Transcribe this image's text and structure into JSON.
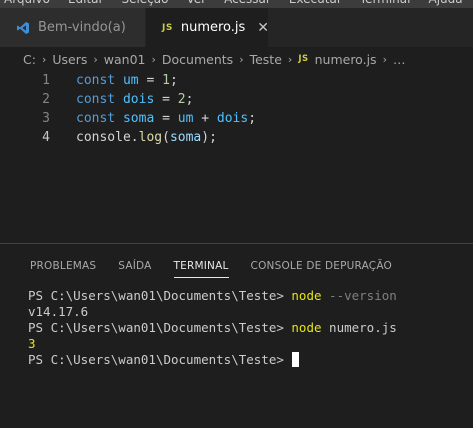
{
  "menu": [
    "Arquivo",
    "Editar",
    "Seleção",
    "Ver",
    "Acessar",
    "Executar",
    "Terminal",
    "Ajuda"
  ],
  "tabs": [
    {
      "label": "Bem-vindo(a)",
      "icon": "vscode-icon"
    },
    {
      "label": "numero.js",
      "icon": "js-file-icon",
      "badge": "JS",
      "close": "✕"
    }
  ],
  "breadcrumb": {
    "items": [
      "C:",
      "Users",
      "wan01",
      "Documents",
      "Teste"
    ],
    "file_badge": "JS",
    "file": "numero.js",
    "more": "…"
  },
  "editor": {
    "line_numbers": [
      "1",
      "2",
      "3",
      "4"
    ],
    "lines": [
      {
        "kw": "const",
        "name": "um",
        "op": "=",
        "val": "1",
        "end": ";"
      },
      {
        "kw": "const",
        "name": "dois",
        "op": "=",
        "val": "2",
        "end": ";"
      },
      {
        "kw": "const",
        "name": "soma",
        "op": "=",
        "a": "um",
        "plus": "+",
        "b": "dois",
        "end": ";"
      },
      {
        "obj": "console",
        "dot": ".",
        "fn": "log",
        "open": "(",
        "arg": "soma",
        "close": ");"
      }
    ]
  },
  "panel": {
    "tabs": [
      "PROBLEMAS",
      "SAÍDA",
      "TERMINAL",
      "CONSOLE DE DEPURAÇÃO"
    ],
    "active_tab": "TERMINAL"
  },
  "terminal": {
    "prompt": "PS C:\\Users\\wan01\\Documents\\Teste>",
    "cmd1": "node",
    "arg1": "--version",
    "out1": "v14.17.6",
    "cmd2": "node",
    "arg2": "numero.js",
    "out2": "3"
  },
  "colors": {
    "background": "#1e1e1e",
    "keyword": "#569cd6",
    "variable": "#4fc1ff",
    "number": "#b5cea8",
    "function": "#dcdcaa",
    "terminal_command": "#e5e510"
  }
}
